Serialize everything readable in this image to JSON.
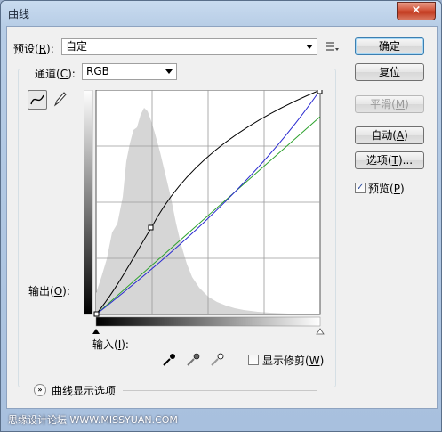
{
  "window": {
    "title": "曲线",
    "close_glyph": "×"
  },
  "preset": {
    "label": "预设(",
    "key": "R",
    "label_end": "):",
    "value": "自定"
  },
  "channel": {
    "label": "通道(",
    "key": "C",
    "label_end": "):",
    "value": "RGB"
  },
  "output": {
    "label": "输出(",
    "key": "O",
    "label_end": "):"
  },
  "input": {
    "label": "输入(",
    "key": "I",
    "label_end": "):"
  },
  "buttons": {
    "ok": "确定",
    "reset": "复位",
    "smooth": "平滑(",
    "smooth_key": "M",
    "smooth_end": ")",
    "auto": "自动(",
    "auto_key": "A",
    "auto_end": ")",
    "options": "选项(",
    "options_key": "T",
    "options_end": ")..."
  },
  "preview": {
    "label": "预览(",
    "key": "P",
    "label_end": ")",
    "checked": true,
    "check_glyph": "✓"
  },
  "show_clipping": {
    "label": "显示修剪(",
    "key": "W",
    "label_end": ")",
    "checked": false
  },
  "curve_display_options": {
    "label": "曲线显示选项",
    "glyph": "»"
  },
  "watermark": "思缘设计论坛  WWW.MISSYUAN.COM",
  "colors": {
    "accent": "#3c7fb1",
    "curve_rgb": "#000000",
    "curve_blue": "#2a2ad0",
    "curve_green": "#2aa02a",
    "histogram": "#d4d4d4"
  }
}
